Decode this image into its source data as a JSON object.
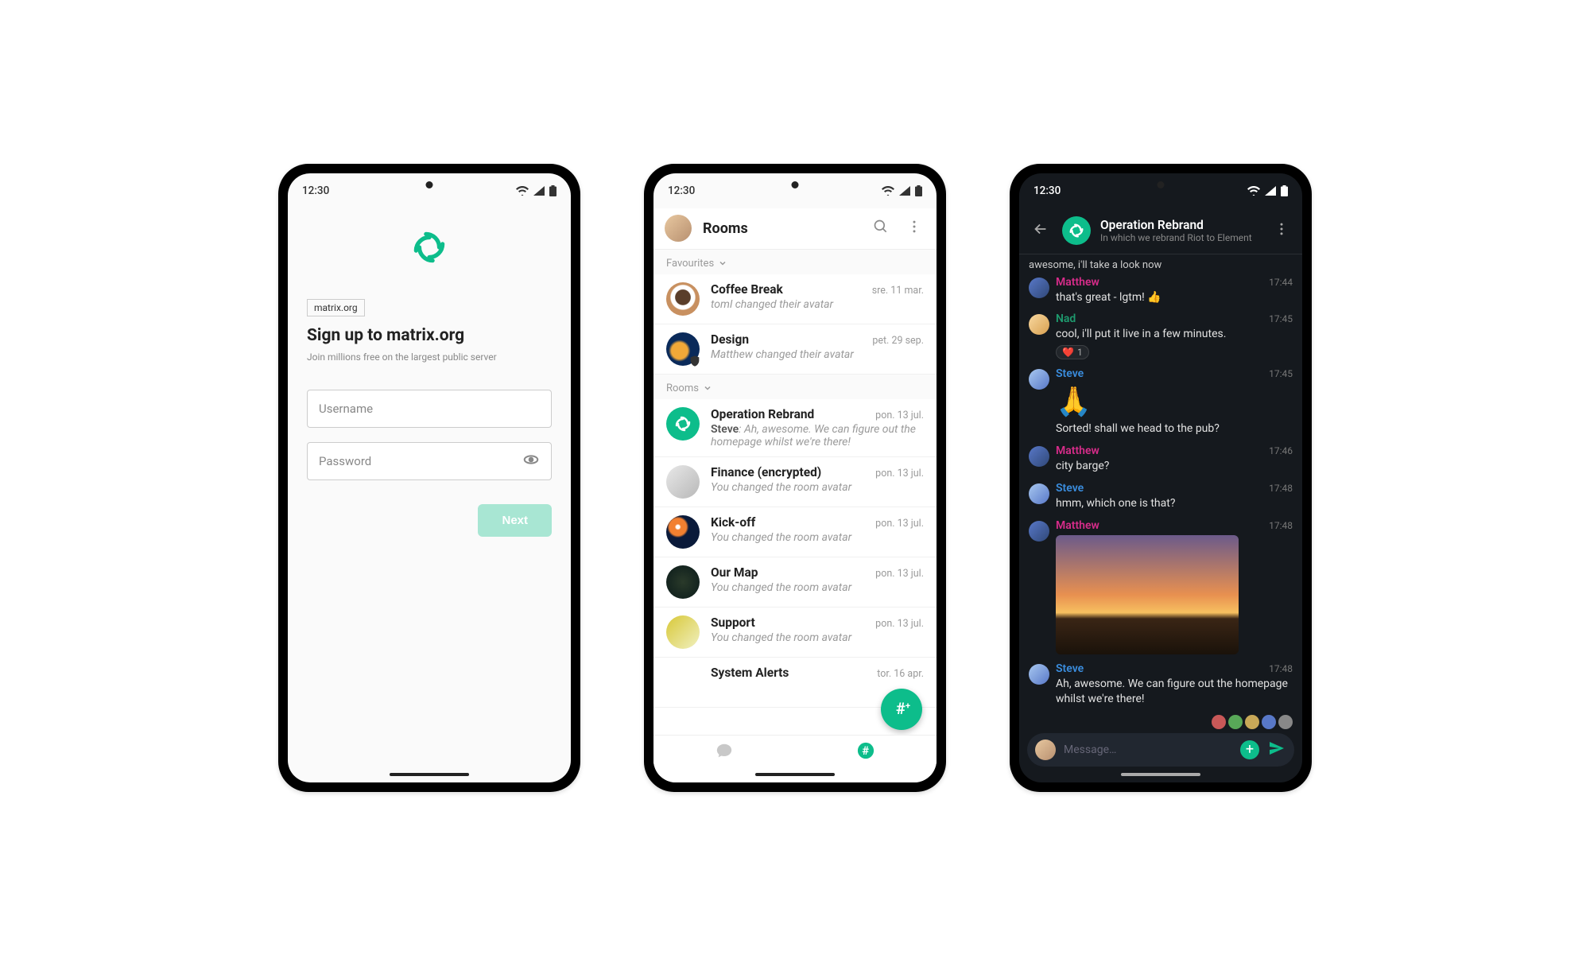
{
  "status": {
    "time": "12:30"
  },
  "screen1": {
    "server_badge": "matrix.org",
    "heading": "Sign up to matrix.org",
    "subheading": "Join millions free on the largest public server",
    "username_placeholder": "Username",
    "password_placeholder": "Password",
    "next_label": "Next"
  },
  "screen2": {
    "title": "Rooms",
    "sections": [
      {
        "label": "Favourites",
        "rooms": [
          {
            "name": "Coffee Break",
            "date": "sre. 11 mar.",
            "sub": "toml changed their avatar",
            "who": "",
            "avatar_bg": "radial-gradient(circle at 50% 45%, #5a3e2a 0 30%, #fff 33% 48%, #c89060 52%)"
          },
          {
            "name": "Design",
            "date": "pet. 29 sep.",
            "sub": "Matthew changed their avatar",
            "who": "",
            "avatar_bg": "radial-gradient(circle at 40% 55%, #f2a838 0 30%, #0a2a5a 40%)",
            "shield": true
          }
        ]
      },
      {
        "label": "Rooms",
        "rooms": [
          {
            "name": "Operation Rebrand",
            "date": "pon. 13 jul.",
            "who": "Steve",
            "sub": "Ah, awesome. We can figure out the homepage whilst we're there!",
            "avatar_bg": "#0dbd8b",
            "logo": true
          },
          {
            "name": "Finance (encrypted)",
            "date": "pon. 13 jul.",
            "sub": "You changed the room avatar",
            "avatar_bg": "linear-gradient(135deg,#e8e8e8,#b8b8b8)"
          },
          {
            "name": "Kick-off",
            "date": "pon. 13 jul.",
            "sub": "You changed the room avatar",
            "avatar_bg": "radial-gradient(circle at 35% 35%, #fff 0 6%, #f28030 10% 28%, #0a1a3a 35%)"
          },
          {
            "name": "Our Map",
            "date": "pon. 13 jul.",
            "sub": "You changed the room avatar",
            "avatar_bg": "radial-gradient(circle, #2a3a2a, #0a1a1a)"
          },
          {
            "name": "Support",
            "date": "pon. 13 jul.",
            "sub": "You changed the room avatar",
            "avatar_bg": "linear-gradient(135deg,#d8c838,#f0f0c0)"
          },
          {
            "name": "System Alerts",
            "date": "tor. 16 apr.",
            "sub": "",
            "avatar_bg": "#fff"
          }
        ]
      }
    ]
  },
  "screen3": {
    "room_name": "Operation Rebrand",
    "room_topic": "In which we rebrand Riot to Element",
    "top_overflow": "awesome, i'll take a look now",
    "messages": [
      {
        "who": "Matthew",
        "color": "pink",
        "time": "17:44",
        "body": "that's great - lgtm! 👍",
        "av_bg": "linear-gradient(135deg,#5878c8,#304878)"
      },
      {
        "who": "Nad",
        "color": "teal",
        "time": "17:45",
        "body": "cool, i'll put it live in a few minutes.",
        "reaction": "❤️",
        "reaction_count": "1",
        "av_bg": "linear-gradient(135deg,#f8d8a0,#d8a050)"
      },
      {
        "who": "Steve",
        "color": "blue",
        "time": "17:45",
        "body": "",
        "pray": true,
        "body2": "Sorted! shall we head to the pub?",
        "av_bg": "linear-gradient(135deg,#a8c8f0,#5878c8)"
      },
      {
        "who": "Matthew",
        "color": "pink",
        "time": "17:46",
        "body": "city barge?",
        "av_bg": "linear-gradient(135deg,#5878c8,#304878)"
      },
      {
        "who": "Steve",
        "color": "blue",
        "time": "17:48",
        "body": "hmm, which one is that?",
        "av_bg": "linear-gradient(135deg,#a8c8f0,#5878c8)"
      },
      {
        "who": "Matthew",
        "color": "pink",
        "time": "17:48",
        "body": "",
        "image": true,
        "av_bg": "linear-gradient(135deg,#5878c8,#304878)"
      },
      {
        "who": "Steve",
        "color": "blue",
        "time": "17:48",
        "body": "Ah, awesome. We can figure out the homepage whilst we're there!",
        "av_bg": "linear-gradient(135deg,#a8c8f0,#5878c8)"
      }
    ],
    "read_avatars": [
      "#c85858",
      "#58a858",
      "#c8a858",
      "#5878c8",
      "#888"
    ],
    "input_placeholder": "Message…"
  }
}
